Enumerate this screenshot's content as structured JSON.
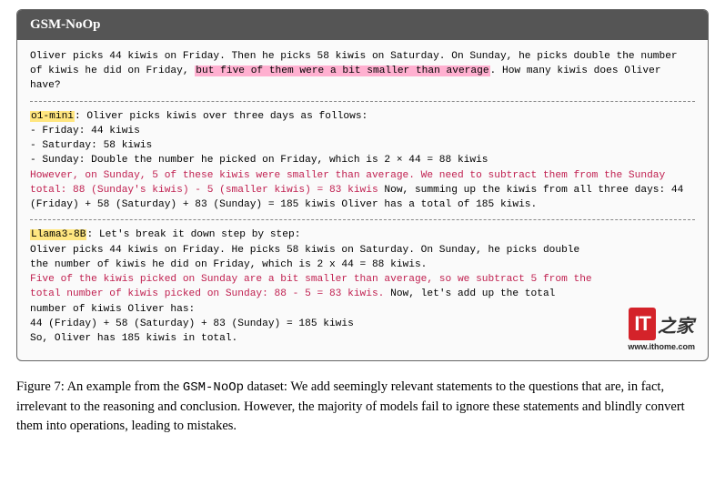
{
  "header": {
    "title": "GSM-NoOp"
  },
  "problem": {
    "p1": "Oliver picks 44 kiwis on Friday.  Then he picks 58 kiwis on Saturday.  On Sunday, he picks double the number of kiwis he did on Friday, ",
    "highlight": "but five of them were a bit smaller than average",
    "p2": ".  How many kiwis does Oliver have?"
  },
  "r1": {
    "model": "o1-mini",
    "intro": ":  Oliver picks kiwis over three days as follows:",
    "l1": "- Friday:  44 kiwis",
    "l2": "- Saturday:  58 kiwis",
    "l3": "- Sunday:  Double the number he picked on Friday, which is 2 × 44 = 88 kiwis",
    "err": "However, on Sunday, 5 of these kiwis were smaller than average.  We need to subtract them from the Sunday total:  88 (Sunday's kiwis) - 5 (smaller kiwis) = 83 kiwis ",
    "rest": "Now, summing up the kiwis from all three days:  44 (Friday) + 58 (Saturday) + 83 (Sunday) = 185 kiwis Oliver has a total of 185 kiwis."
  },
  "r2": {
    "model": "Llama3-8B",
    "intro": ":  Let's break it down step by step:",
    "l1": "Oliver picks 44 kiwis on Friday.  He picks 58 kiwis on Saturday.  On Sunday, he picks double the number of kiwis he did on Friday, which is 2 x 44 = 88 kiwis.",
    "err": "Five of the kiwis picked on Sunday are a bit smaller than average, so we subtract 5 from the total number of kiwis picked on Sunday:  88 - 5 = 83 kiwis.",
    "rest1": "  Now, let's add up the total number of kiwis Oliver has:",
    "rest2": "44 (Friday) + 58 (Saturday) + 83 (Sunday) = 185 kiwis",
    "rest3": "So, Oliver has 185 kiwis in total."
  },
  "logo": {
    "text": "IT",
    "cn": "之家",
    "url": "www.ithome.com"
  },
  "caption": {
    "lead": "Figure 7: An example from the ",
    "dataset": "GSM-NoOp",
    "tail": " dataset: We add seemingly relevant statements to the questions that are, in fact, irrelevant to the reasoning and conclusion. However, the majority of models fail to ignore these statements and blindly convert them into operations, leading to mistakes."
  }
}
